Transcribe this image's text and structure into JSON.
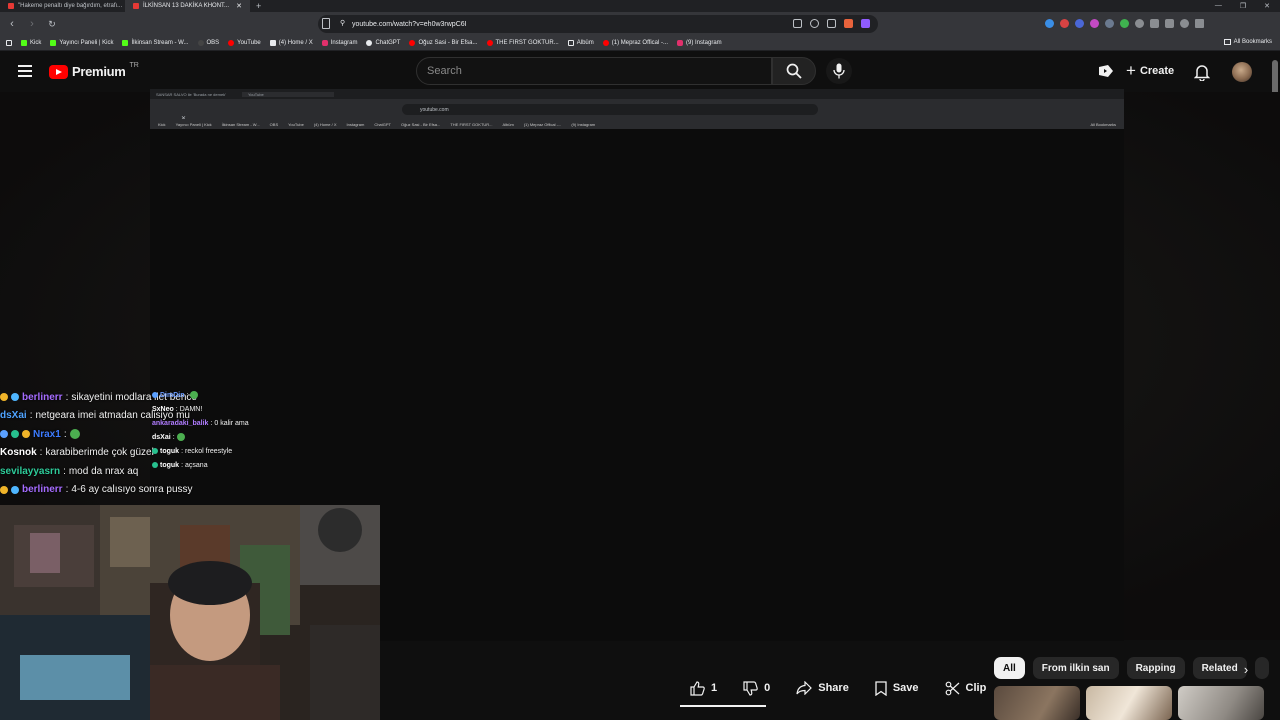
{
  "browser": {
    "tabs": [
      {
        "title": "\"Hakeme penaltı diye bağırdım, etrafı...",
        "active": false
      },
      {
        "title": "İLKİNSAN 13 DAKİKA KHONT...",
        "active": true
      }
    ],
    "new_tab": "+",
    "url": "youtube.com/watch?v=eh0w3rwpC6I",
    "bookmarks": [
      "Kick",
      "Yayıncı Paneli | Kick",
      "İlkinsan Stream - W...",
      "OBS",
      "YouTube",
      "(4) Home / X",
      "Instagram",
      "ChatGPT",
      "Oğuz Sasi - Bir Efsa...",
      "THE FIRST GOKTUR...",
      "Albüm",
      "(1) Mepraz Offical -...",
      "(9) Instagram"
    ],
    "all_bookmarks": "All Bookmarks"
  },
  "youtube": {
    "logo_text": "Premium",
    "region": "TR",
    "search_placeholder": "Search",
    "create_label": "Create"
  },
  "inner_browser": {
    "tabs": [
      "SANSAR SALVO ile 'Burada ne demek'",
      "YouTube"
    ],
    "url": "youtube.com",
    "bookmarks": [
      "Kick",
      "Yayıncı Paneli | Kick",
      "İlkinsan Stream - W...",
      "OBS",
      "YouTube",
      "(4) Home / X",
      "Instagram",
      "ChatGPT",
      "Oğuz Sasi - Bir Efsa...",
      "THE FIRST GOKTUR...",
      "Albüm",
      "(1) Mepraz Offical -...",
      "(9) Instagram"
    ],
    "all_bookmarks": "All Bookmarks"
  },
  "chat": [
    {
      "user": "berlinerr",
      "message": "sikayetini modlara ilet bence",
      "color": "#a56cff"
    },
    {
      "user": "dsXai",
      "message": "netgeara imei atmadan calisiyo mu",
      "color": "#4fa3ff"
    },
    {
      "user": "Nrax1",
      "message": "",
      "color": "#3d7cff"
    },
    {
      "user": "Kosnok",
      "message": "karabiberimde çok güzel",
      "color": "#ffffff"
    },
    {
      "user": "sevilayyasrn",
      "message": "mod da nrax aq",
      "color": "#2ecc9a"
    },
    {
      "user": "berlinerr",
      "message": "4-6 ay calısıyo sonra pussy",
      "color": "#a56cff"
    }
  ],
  "inner_chat": [
    {
      "user": "DimDin",
      "message": "",
      "color": "#6a9bff"
    },
    {
      "user": "SxNeo",
      "message": "DAMN!",
      "color": "#ffffff"
    },
    {
      "user": "ankaradaki_balik",
      "message": "0 kalir ama",
      "color": "#b07cff"
    },
    {
      "user": "dsXai",
      "message": "",
      "color": "#ffffff"
    },
    {
      "user": "toguk",
      "message": "reckol freestyle",
      "color": "#ffffff"
    },
    {
      "user": "toguk",
      "message": "açsana",
      "color": "#ffffff"
    }
  ],
  "actions": {
    "like_count": "1",
    "dislike_count": "0",
    "share": "Share",
    "save": "Save",
    "clip": "Clip"
  },
  "chips": [
    "All",
    "From ilkin san",
    "Rapping",
    "Related"
  ],
  "icons": [
    "menu-icon",
    "search-icon",
    "mic-icon",
    "create-video-icon",
    "bell-icon",
    "like-icon",
    "dislike-icon",
    "share-icon",
    "save-icon",
    "clip-icon",
    "more-icon",
    "chevron-right-icon"
  ]
}
